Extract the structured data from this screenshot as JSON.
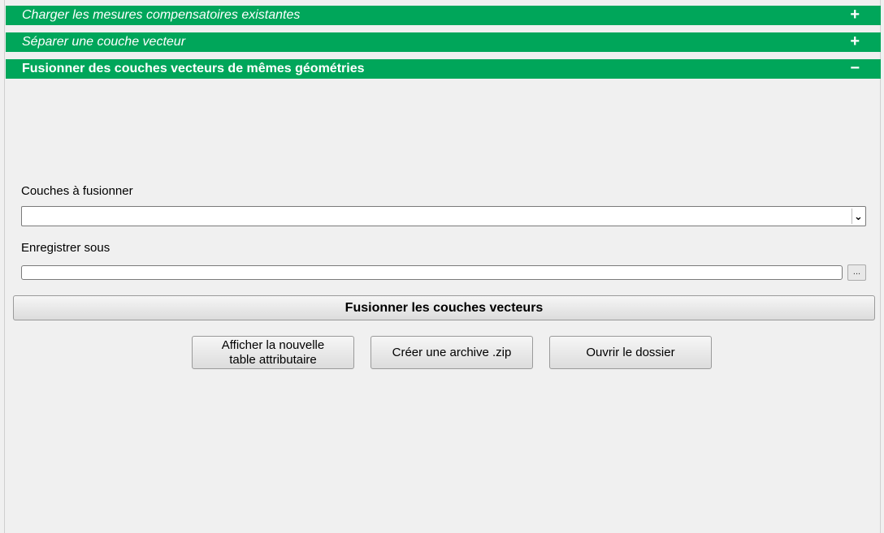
{
  "sections": [
    {
      "title": "Charger les mesures compensatoires existantes",
      "toggle": "+"
    },
    {
      "title": "Séparer une couche vecteur",
      "toggle": "+"
    },
    {
      "title": "Fusionner des couches vecteurs de mêmes géométries",
      "toggle": "−"
    }
  ],
  "form": {
    "layers_label": "Couches à fusionner",
    "layers_value": "",
    "combo_arrow": "⌄",
    "save_label": "Enregistrer sous",
    "save_value": "",
    "browse_label": "...",
    "merge_button": "Fusionner les couches vecteurs"
  },
  "actions": {
    "show_table": "Afficher la nouvelle\ntable attributaire",
    "create_zip": "Créer une archive .zip",
    "open_folder": "Ouvrir le dossier"
  }
}
